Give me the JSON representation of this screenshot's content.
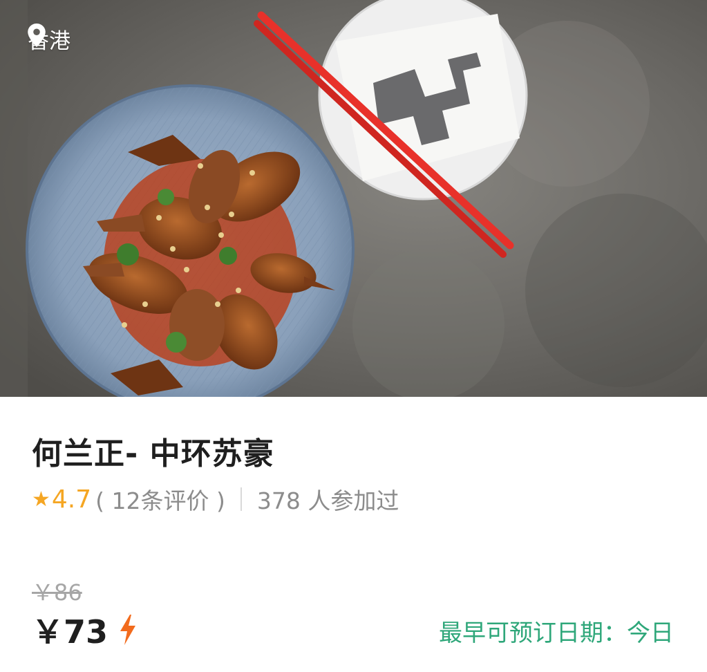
{
  "hero": {
    "location": "香港",
    "location_icon": "location-pin-icon"
  },
  "listing": {
    "title": "何兰正- 中环苏豪",
    "rating_icon": "star-icon",
    "rating": "4.7",
    "reviews": "( 12条评价 )",
    "participants": "378 人参加过",
    "original_price": "￥86",
    "price": "￥73",
    "price_icon": "lightning-icon",
    "booking": "最早可预订日期：今日"
  },
  "colors": {
    "rating": "#f5a623",
    "booking": "#2fa77a",
    "bolt": "#f26b1d",
    "chopsticks": "#e8312a"
  }
}
